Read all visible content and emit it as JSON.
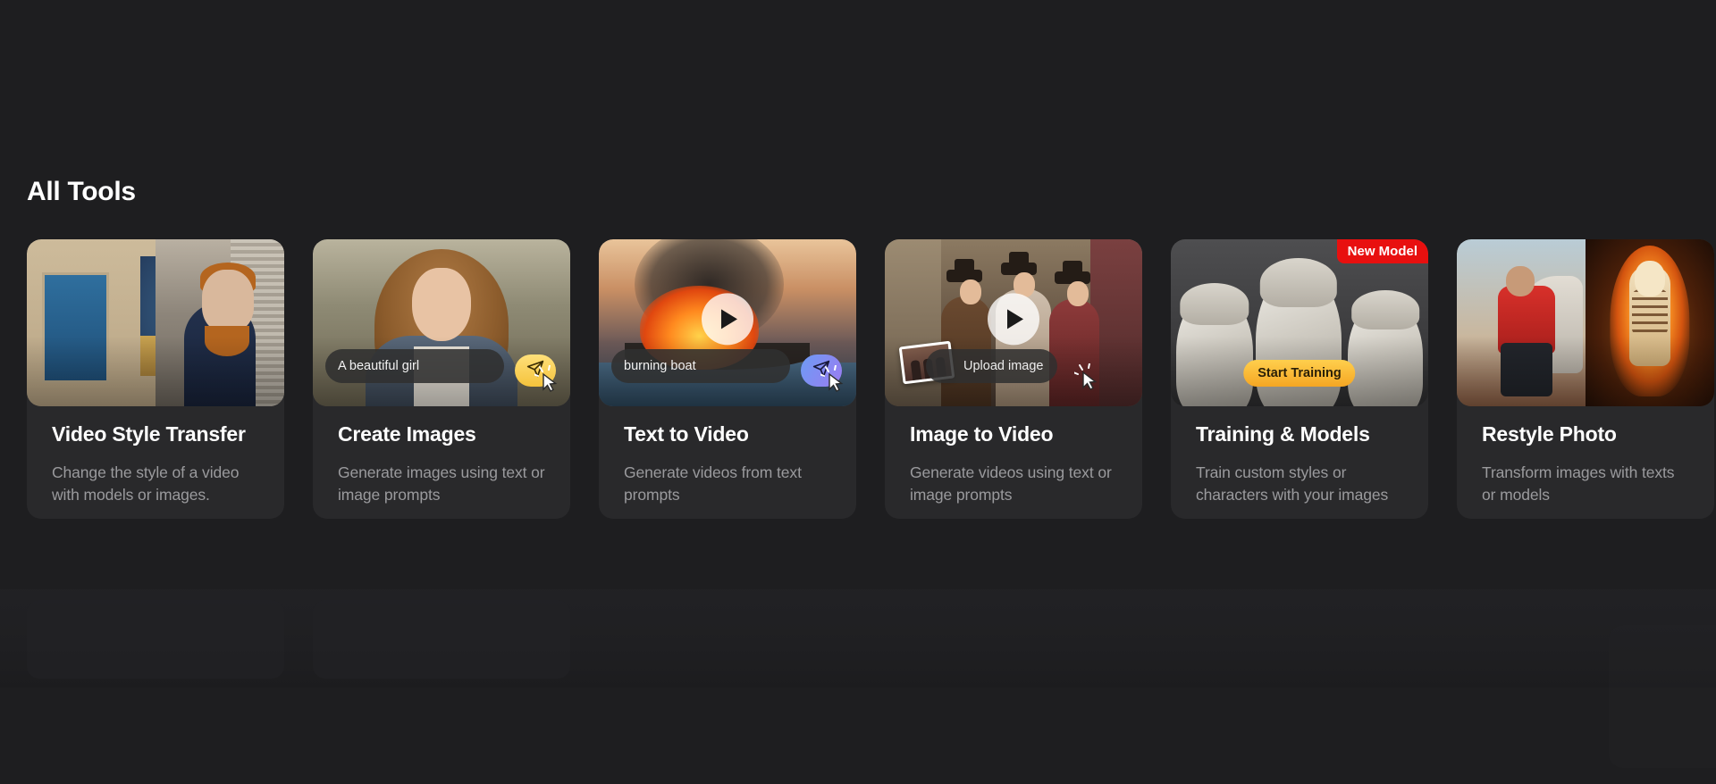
{
  "section": {
    "title": "All Tools"
  },
  "colors": {
    "page_bg": "#1e1e20",
    "card_bg": "#29292b",
    "title_text": "#ffffff",
    "desc_text": "#9a9a9d",
    "badge_red": "#e8100f",
    "train_amber": "#f5a623",
    "send_amber": "#ffd04d",
    "send_violet": "#8b7cf0"
  },
  "cards": [
    {
      "title": "Video Style Transfer",
      "desc": "Change the style of a video with models or images.",
      "overlay": {}
    },
    {
      "title": "Create Images",
      "desc": "Generate images using text or image prompts",
      "overlay": {
        "prompt": "A beautiful girl",
        "send_icon": "send-icon"
      }
    },
    {
      "title": "Text to Video",
      "desc": "Generate videos from text prompts",
      "overlay": {
        "prompt": "burning boat",
        "send_icon": "send-icon",
        "play_icon": "play-icon"
      }
    },
    {
      "title": "Image to Video",
      "desc": "Generate videos using text or image prompts",
      "overlay": {
        "upload_label": "Upload image",
        "play_icon": "play-icon"
      }
    },
    {
      "title": "Training & Models",
      "desc": "Train custom styles or characters with your images",
      "overlay": {
        "badge": "New Model",
        "button": "Start Training"
      }
    },
    {
      "title": "Restyle Photo",
      "desc": "Transform images with texts or models",
      "overlay": {}
    }
  ]
}
